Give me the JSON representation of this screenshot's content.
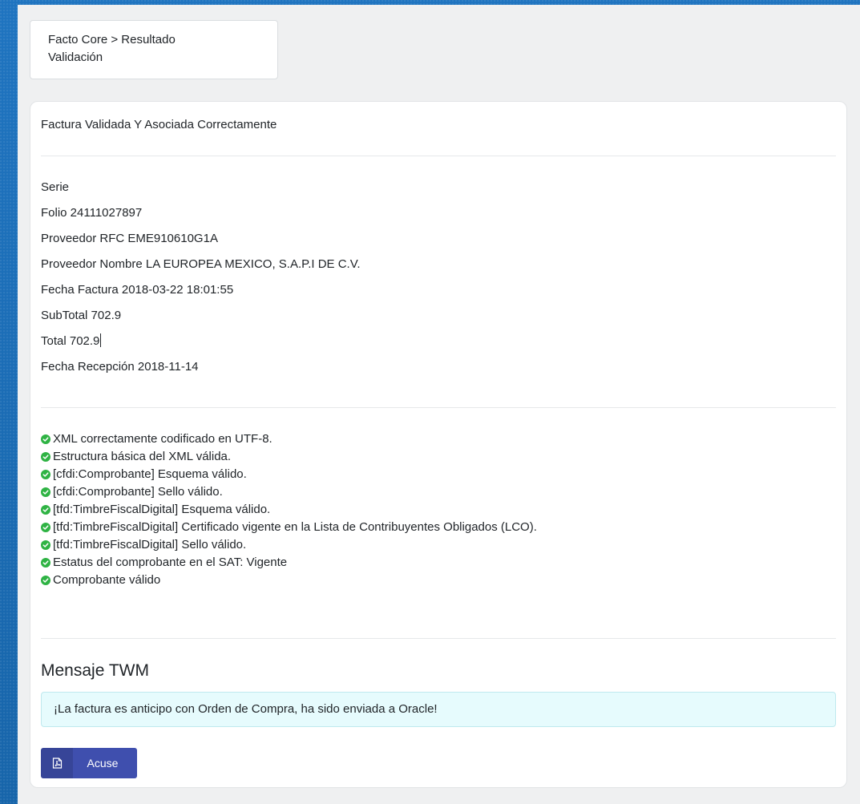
{
  "breadcrumb": {
    "line1": "Facto Core > Resultado",
    "line2": "Validación"
  },
  "result": {
    "title": "Factura Validada Y Asociada Correctamente"
  },
  "fields": [
    "Serie",
    "Folio 24111027897",
    "Proveedor RFC EME910610G1A",
    "Proveedor Nombre LA EUROPEA MEXICO, S.A.P.I DE C.V.",
    "Fecha Factura 2018-03-22 18:01:55",
    "SubTotal 702.9",
    "Total 702.9",
    "Fecha Recepción 2018-11-14"
  ],
  "checks": [
    "XML correctamente codificado en UTF-8.",
    "Estructura básica del XML válida.",
    "[cfdi:Comprobante] Esquema válido.",
    "[cfdi:Comprobante] Sello válido.",
    "[tfd:TimbreFiscalDigital] Esquema válido.",
    "[tfd:TimbreFiscalDigital] Certificado vigente en la Lista de Contribuyentes Obligados (LCO).",
    "[tfd:TimbreFiscalDigital] Sello válido.",
    "Estatus del comprobante en el SAT: Vigente",
    "Comprobante válido"
  ],
  "message": {
    "title": "Mensaje TWM",
    "text": "¡La factura es anticipo con Orden de Compra, ha sido enviada a Oracle!"
  },
  "actions": {
    "acuse_label": "Acuse",
    "acuse_icon": "pdf-file-icon"
  },
  "colors": {
    "check": "#2fb344",
    "button": "#3f4fae",
    "alert_bg": "#e6fbfd"
  }
}
